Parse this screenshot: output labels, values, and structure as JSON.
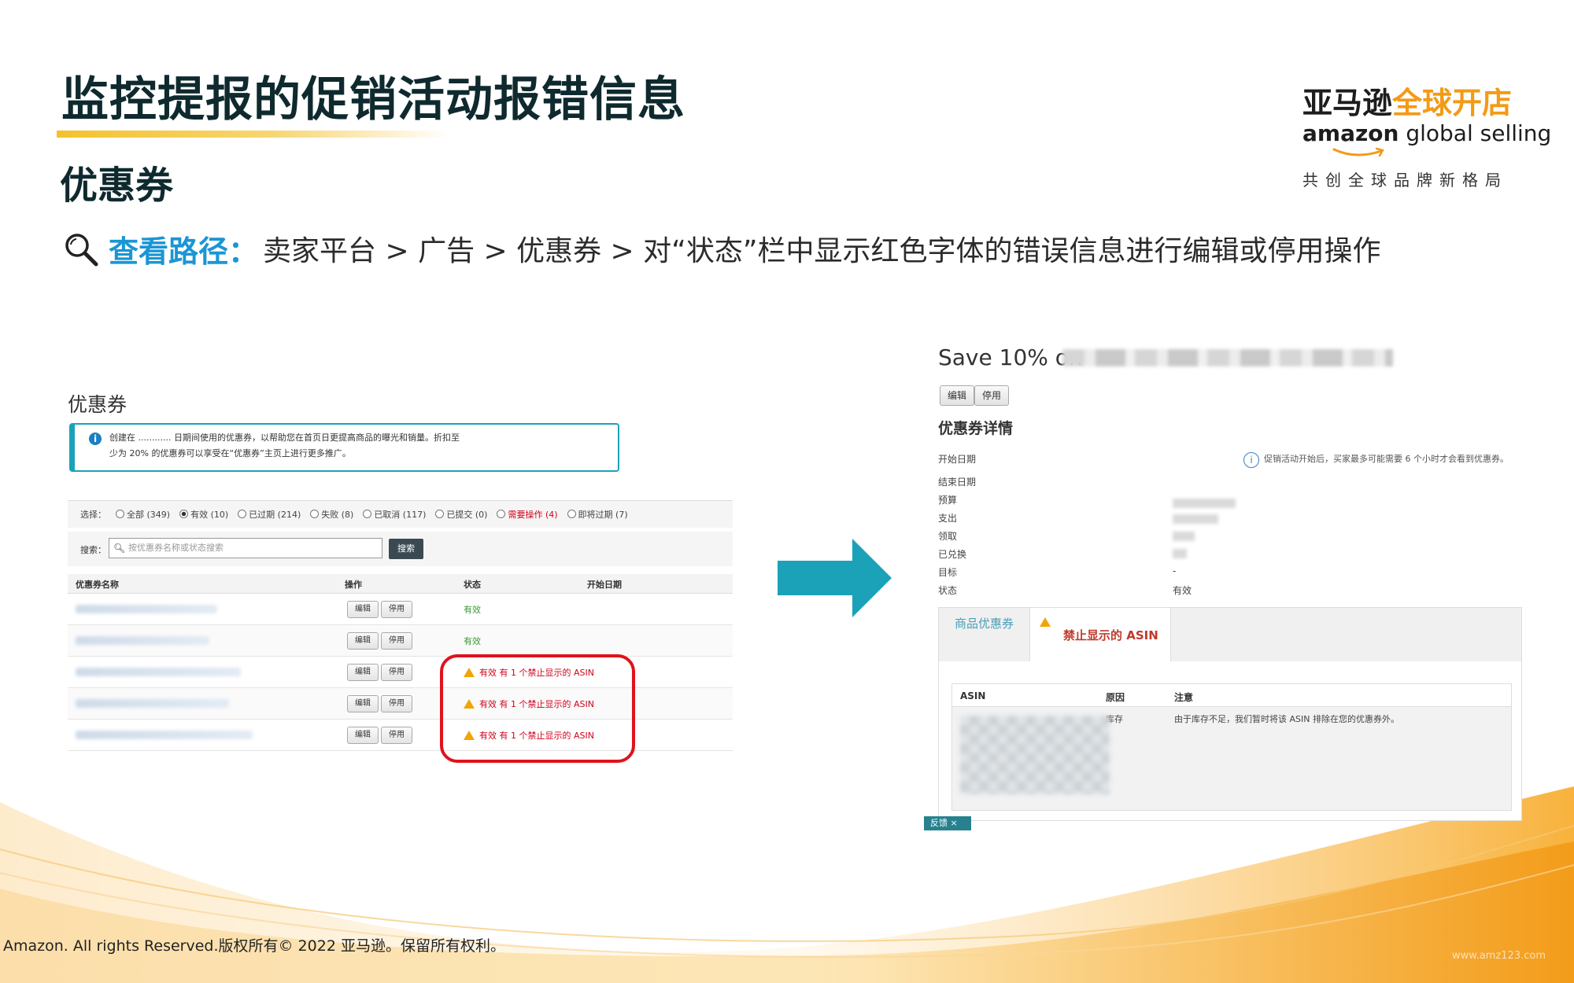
{
  "header": {
    "title": "监控提报的促销活动报错信息",
    "subtitle": "优惠券",
    "path_label": "查看路径：",
    "path_text": "卖家平台 > 广告 > 优惠券 > 对“状态”栏中显示红色字体的错误信息进行编辑或停用操作"
  },
  "logo": {
    "cn_dark": "亚马逊",
    "cn_orange": "全球开店",
    "en_bold": "amazon",
    "en_light": " global selling",
    "slogan": "共创全球品牌新格局"
  },
  "left_panel": {
    "heading": "优惠券",
    "info_line1": "创建在 ............ 日期间使用的优惠券，以帮助您在首页日更提高商品的曝光和销量。折扣至",
    "info_line2": "少为 20% 的优惠券可以享受在“优惠券”主页上进行更多推广。",
    "filter_label": "选择：",
    "filters": [
      {
        "label": "全部 (349)",
        "checked": false,
        "red": false
      },
      {
        "label": "有效 (10)",
        "checked": true,
        "red": false
      },
      {
        "label": "已过期 (214)",
        "checked": false,
        "red": false
      },
      {
        "label": "失败 (8)",
        "checked": false,
        "red": false
      },
      {
        "label": "已取消 (117)",
        "checked": false,
        "red": false
      },
      {
        "label": "已提交 (0)",
        "checked": false,
        "red": false
      },
      {
        "label": "需要操作 (4)",
        "checked": false,
        "red": true
      },
      {
        "label": "即将过期 (7)",
        "checked": false,
        "red": false
      }
    ],
    "search_label": "搜索：",
    "search_placeholder": "按优惠券名称或状态搜索",
    "search_button": "搜索",
    "columns": [
      "优惠券名称",
      "操作",
      "状态",
      "开始日期"
    ],
    "edit_label": "编辑",
    "disable_label": "停用",
    "rows": [
      {
        "status": "有效",
        "error": false
      },
      {
        "status": "有效",
        "error": false
      },
      {
        "status": "有效 有 1 个禁止显示的 ASIN",
        "error": true
      },
      {
        "status": "有效 有 1 个禁止显示的 ASIN",
        "error": true
      },
      {
        "status": "有效 有 1 个禁止显示的 ASIN",
        "error": true
      }
    ]
  },
  "right_panel": {
    "title": "Save 10% on",
    "edit_button": "编辑",
    "disable_button": "停用",
    "detail_title": "优惠券详情",
    "labels": [
      "开始日期",
      "结束日期",
      "预算",
      "支出",
      "领取",
      "已兑换",
      "目标",
      "状态"
    ],
    "target_value": "-",
    "status_value": "有效",
    "note": "促销活动开始后，买家最多可能需要 6 个小时才会看到优惠券。",
    "tab_coupon": "商品优惠券",
    "tab_suppressed": "禁止显示的 ASIN",
    "table_columns": [
      "ASIN",
      "原因",
      "注意"
    ],
    "row_reason": "库存",
    "row_note": "由于库存不足，我们暂时将该 ASIN 排除在您的优惠券外。",
    "feedback": "反馈"
  },
  "footer": {
    "copyright": "Amazon. All rights Reserved.版权所有© 2022 亚马逊。保留所有权利。",
    "watermark": "www.amz123.com"
  },
  "colors": {
    "accent_blue": "#1a96d4",
    "teal": "#1ca2b8",
    "highlight_red": "#e0121c",
    "brand_orange": "#f39a16",
    "title_dark": "#0f2a2e"
  }
}
